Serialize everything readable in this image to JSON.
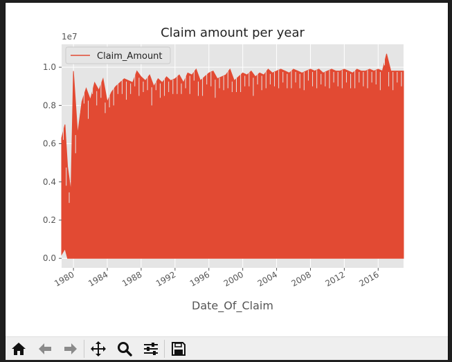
{
  "chart_data": {
    "type": "line",
    "title": "Claim amount per year",
    "xlabel": "Date_Of_Claim",
    "ylabel": "",
    "offset_label": "1e7",
    "legend": {
      "entries": [
        "Claim_Amount"
      ],
      "placement": "top-left"
    },
    "x_ticks": [
      "1980",
      "1984",
      "1988",
      "1992",
      "1996",
      "2000",
      "2004",
      "2008",
      "2012",
      "2016"
    ],
    "y_ticks": [
      "0.0",
      "0.2",
      "0.4",
      "0.6",
      "0.8",
      "1.0"
    ],
    "xlim": [
      1978.6,
      2019.0
    ],
    "ylim": [
      -0.05,
      1.12
    ],
    "grid": true,
    "series": [
      {
        "name": "Claim_Amount",
        "color": "#E24A33",
        "x": [
          1978.6,
          1979.0,
          1979.3,
          1979.7,
          1980.0,
          1980.5,
          1981.0,
          1981.5,
          1982.0,
          1982.5,
          1983.0,
          1983.5,
          1984.0,
          1984.5,
          1985.0,
          1985.5,
          1986.0,
          1986.5,
          1987.0,
          1987.5,
          1988.0,
          1988.5,
          1989.0,
          1989.5,
          1990.0,
          1990.5,
          1991.0,
          1991.5,
          1992.0,
          1992.5,
          1993.0,
          1993.5,
          1994.0,
          1994.5,
          1995.0,
          1995.5,
          1996.0,
          1996.5,
          1997.0,
          1997.5,
          1998.0,
          1998.5,
          1999.0,
          1999.5,
          2000.0,
          2000.5,
          2001.0,
          2001.5,
          2002.0,
          2002.5,
          2003.0,
          2003.5,
          2004.0,
          2004.5,
          2005.0,
          2005.5,
          2006.0,
          2006.5,
          2007.0,
          2007.5,
          2008.0,
          2008.5,
          2009.0,
          2009.5,
          2010.0,
          2010.5,
          2011.0,
          2011.5,
          2012.0,
          2012.5,
          2013.0,
          2013.5,
          2014.0,
          2014.5,
          2015.0,
          2015.5,
          2016.0,
          2016.5,
          2017.0,
          2017.5,
          2018.0,
          2018.5,
          2019.0
        ],
        "upper": [
          0.63,
          0.7,
          0.48,
          0.35,
          0.98,
          0.65,
          0.82,
          0.89,
          0.83,
          0.92,
          0.88,
          0.94,
          0.82,
          0.87,
          0.9,
          0.92,
          0.94,
          0.93,
          0.92,
          0.98,
          0.95,
          0.93,
          0.96,
          0.9,
          0.94,
          0.92,
          0.95,
          0.93,
          0.94,
          0.96,
          0.92,
          0.97,
          0.96,
          0.99,
          0.93,
          0.95,
          0.97,
          0.98,
          0.94,
          0.95,
          0.96,
          0.99,
          0.93,
          0.95,
          0.97,
          0.96,
          0.98,
          0.95,
          0.97,
          0.96,
          0.99,
          0.97,
          0.98,
          0.99,
          0.98,
          0.97,
          0.99,
          0.98,
          0.97,
          0.98,
          0.99,
          0.98,
          0.99,
          0.97,
          0.98,
          0.99,
          0.98,
          0.98,
          0.99,
          0.98,
          0.97,
          0.99,
          0.98,
          0.98,
          0.99,
          0.98,
          0.99,
          0.98,
          1.07,
          0.98,
          0.98,
          0.98,
          0.98
        ],
        "lower": [
          0.02,
          0.05,
          0.0,
          0.0,
          0.0,
          0.0,
          0.0,
          0.0,
          0.0,
          0.0,
          0.0,
          0.0,
          0.0,
          0.0,
          0.0,
          0.0,
          0.0,
          0.0,
          0.0,
          0.0,
          0.0,
          0.0,
          0.0,
          0.0,
          0.0,
          0.0,
          0.0,
          0.0,
          0.0,
          0.0,
          0.0,
          0.0,
          0.0,
          0.0,
          0.0,
          0.0,
          0.0,
          0.0,
          0.0,
          0.0,
          0.0,
          0.0,
          0.0,
          0.0,
          0.0,
          0.0,
          0.0,
          0.0,
          0.0,
          0.0,
          0.0,
          0.0,
          0.0,
          0.0,
          0.0,
          0.0,
          0.0,
          0.0,
          0.0,
          0.0,
          0.0,
          0.0,
          0.0,
          0.0,
          0.0,
          0.0,
          0.0,
          0.0,
          0.0,
          0.0,
          0.0,
          0.0,
          0.0,
          0.0,
          0.0,
          0.0,
          0.0,
          0.0,
          0.0,
          0.0,
          0.0,
          0.0,
          0.0
        ]
      }
    ]
  },
  "toolbar": {
    "buttons": [
      {
        "name": "home-icon",
        "tooltip": "Home"
      },
      {
        "name": "back-arrow-icon",
        "tooltip": "Back"
      },
      {
        "name": "forward-arrow-icon",
        "tooltip": "Forward"
      },
      {
        "name": "pan-icon",
        "tooltip": "Pan"
      },
      {
        "name": "zoom-icon",
        "tooltip": "Zoom"
      },
      {
        "name": "configure-subplots-icon",
        "tooltip": "Subplots"
      },
      {
        "name": "save-icon",
        "tooltip": "Save"
      }
    ]
  },
  "colors": {
    "axes_bg": "#E5E5E5",
    "grid": "#FFFFFF",
    "series": "#E24A33",
    "toolbar_bg": "#EFEFEF"
  }
}
